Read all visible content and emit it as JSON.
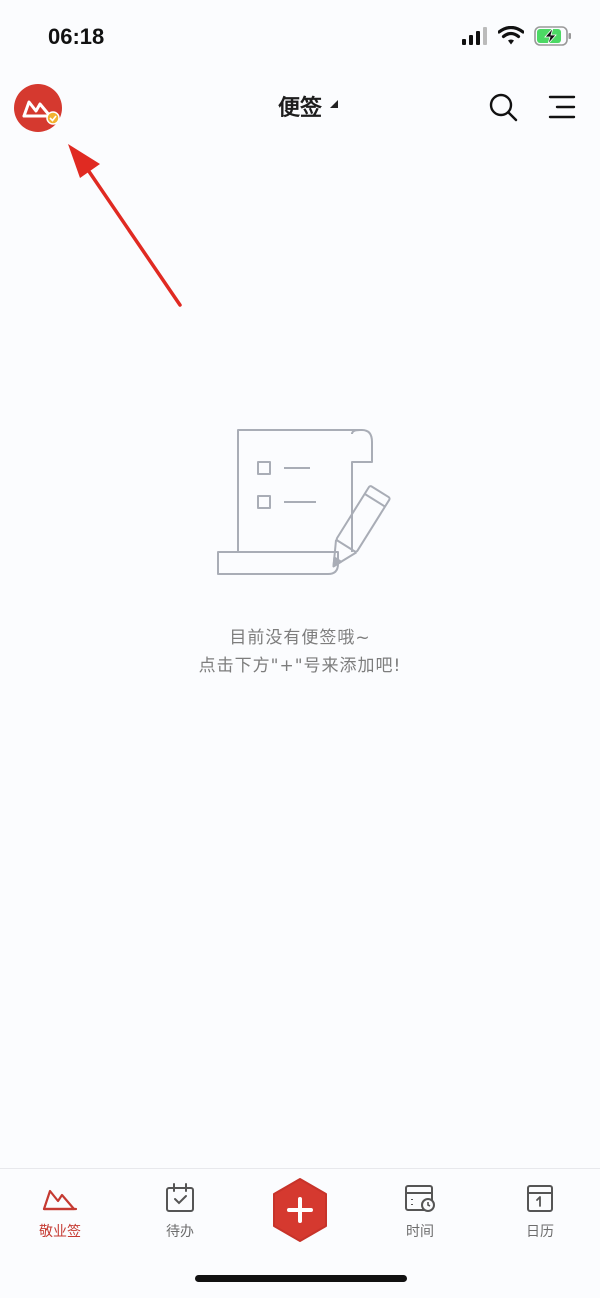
{
  "status_bar": {
    "time": "06:18",
    "icons": [
      "cellular-signal-icon",
      "wifi-icon",
      "battery-charging-icon"
    ]
  },
  "header": {
    "title": "便签",
    "left_icon": "app-logo-avatar",
    "right_icons": [
      "search-icon",
      "menu-icon"
    ]
  },
  "empty_state": {
    "line1": "目前没有便签哦~",
    "line2": "点击下方\"+\"号来添加吧!"
  },
  "tabbar": {
    "items": [
      {
        "label": "敬业签",
        "icon": "notes-cloud-icon",
        "active": true
      },
      {
        "label": "待办",
        "icon": "todo-calendar-icon",
        "active": false
      },
      {
        "label": "",
        "icon": "add-icon",
        "active": false
      },
      {
        "label": "时间",
        "icon": "time-calendar-icon",
        "active": false
      },
      {
        "label": "日历",
        "icon": "calendar-icon",
        "active": false
      }
    ]
  },
  "colors": {
    "brand_red": "#d5392f",
    "active_tab": "#c53a32",
    "background": "#fbfcfe",
    "annotation_arrow": "#e02a22"
  }
}
